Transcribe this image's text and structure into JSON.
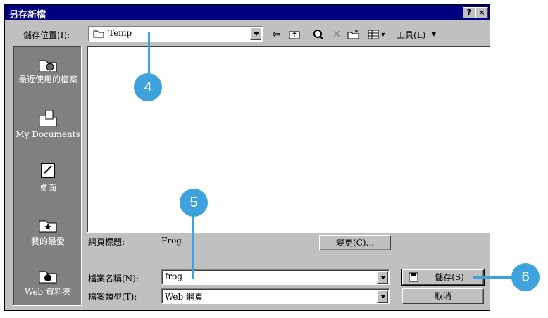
{
  "dialog": {
    "title": "另存新檔",
    "help_btn": "?",
    "close_btn": "×"
  },
  "top": {
    "save_in_label": "儲存位置(I):",
    "save_in_value": "Temp",
    "tools_label": "工具(L)",
    "tools_arrow": "▾"
  },
  "places": [
    {
      "label": "最近使用的檔案"
    },
    {
      "label": "My Documents"
    },
    {
      "label": "桌面"
    },
    {
      "label": "我的最愛"
    },
    {
      "label": "Web 資料夾"
    }
  ],
  "page_title": {
    "label": "網頁標題:",
    "value": "Frog",
    "change_button": "變更(C)..."
  },
  "file_name": {
    "label": "檔案名稱(N):",
    "value": "frog"
  },
  "file_type": {
    "label": "檔案類型(T):",
    "value": "Web 網頁"
  },
  "buttons": {
    "save": "儲存(S)",
    "cancel": "取消"
  },
  "callouts": [
    "4",
    "5",
    "6"
  ]
}
